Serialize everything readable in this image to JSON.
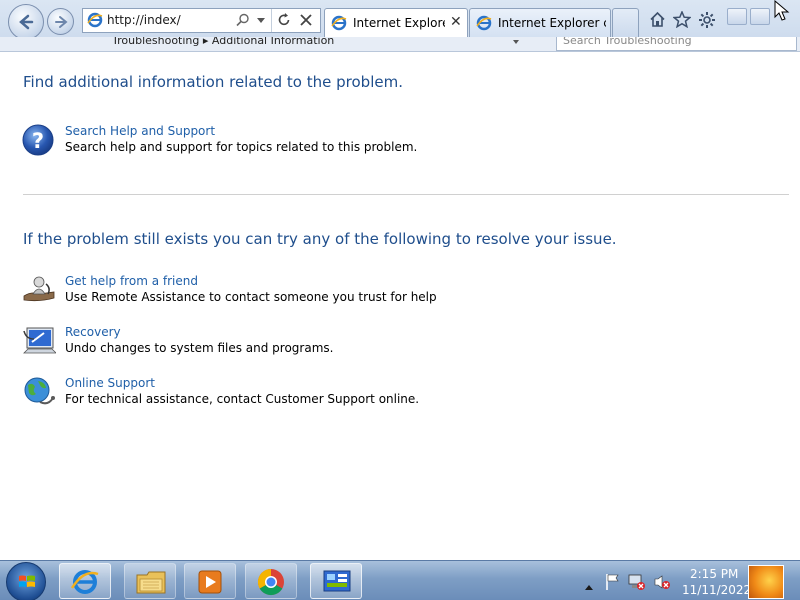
{
  "browser": {
    "address": {
      "url": "http://index/"
    },
    "tabs": [
      {
        "label": "Internet Explore..."
      },
      {
        "label": "Internet Explorer c..."
      }
    ],
    "command_bar": {
      "breadcrumb": "Troubleshooting  ▸  Additional Information",
      "search_placeholder": "Search Troubleshooting"
    }
  },
  "content": {
    "heading_1": "Find additional information related to the problem.",
    "help_option": {
      "title": "Search Help and Support",
      "description": "Search help and support for topics related to this problem."
    },
    "heading_2": "If the problem still exists you can try any of the following to resolve your issue.",
    "options": [
      {
        "title": "Get help from a friend",
        "description": "Use Remote Assistance to contact someone you trust for help",
        "icon": "remote-assistance-icon"
      },
      {
        "title": "Recovery",
        "description": "Undo changes to system files and programs.",
        "icon": "recovery-icon"
      },
      {
        "title": "Online Support",
        "description": "For technical assistance, contact Customer Support online.",
        "icon": "online-support-icon"
      }
    ]
  },
  "taskbar": {
    "pinned": [
      "internet-explorer-icon",
      "folder-icon",
      "media-player-icon",
      "chrome-icon",
      "control-panel-icon"
    ],
    "clock": {
      "time": "2:15 PM",
      "date": "11/11/2022"
    }
  },
  "colors": {
    "heading": "#1f4e8c",
    "link": "#1f5fa8",
    "taskbar": "#7e9ec5"
  }
}
